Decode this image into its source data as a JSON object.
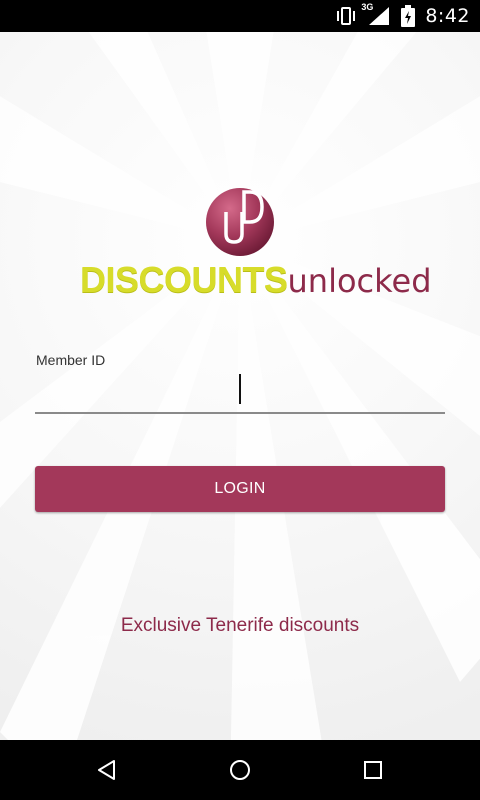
{
  "status_bar": {
    "network_type": "3G",
    "time": "8:42",
    "icons": [
      "vibrate-icon",
      "signal-icon",
      "battery-icon"
    ]
  },
  "logo": {
    "mark_letters": "UD",
    "word_bold": "DISCOUNTS",
    "word_light": "unlocked",
    "colors": {
      "bold": "#d7dc2a",
      "light": "#8d2a4a",
      "mark": "#a3385a"
    }
  },
  "form": {
    "member_id_label": "Member ID",
    "member_id_value": "",
    "login_label": "LOGIN"
  },
  "tagline": "Exclusive Tenerife discounts",
  "colors": {
    "accent": "#a3385a",
    "tagline": "#8d2a4a"
  },
  "nav_bar": {
    "buttons": [
      "back-icon",
      "home-icon",
      "recents-icon"
    ]
  }
}
